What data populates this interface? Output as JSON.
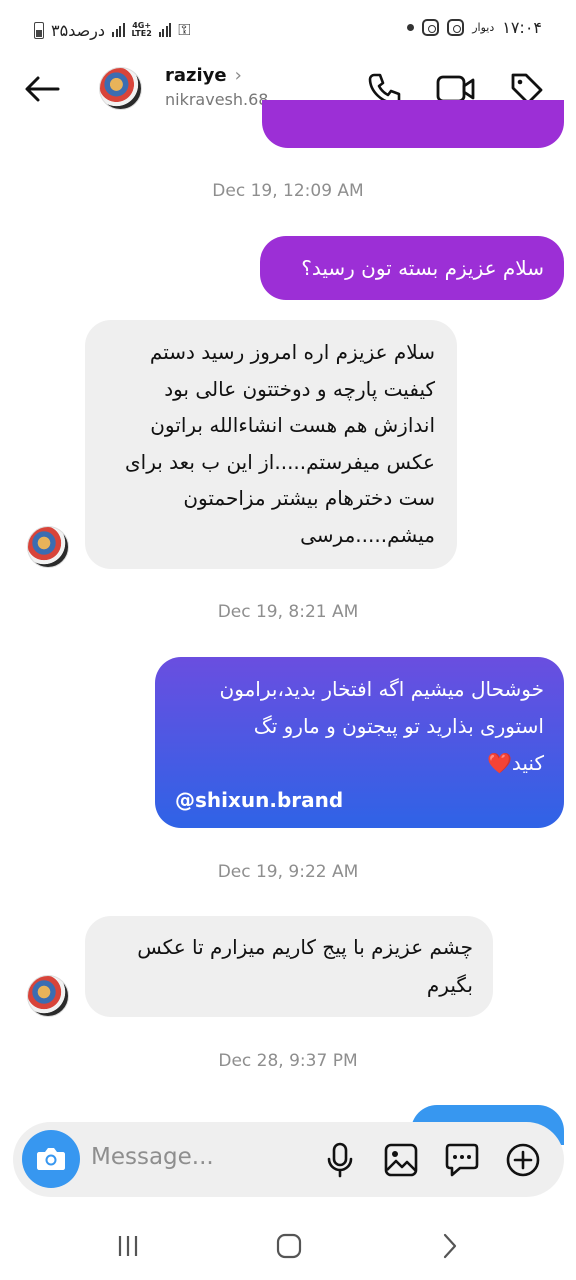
{
  "status_bar": {
    "battery_text": "۳۵درصد",
    "network": "4G+ Vo LTE2",
    "carrier": "دیوار",
    "time": "۱۷:۰۴"
  },
  "header": {
    "name": "raziye",
    "username": "nikravesh.68",
    "chevron": "›"
  },
  "timestamps": {
    "t1": "Dec 19, 12:09 AM",
    "t2": "Dec 19, 8:21 AM",
    "t3": "Dec 19, 9:22 AM",
    "t4": "Dec 28, 9:37 PM"
  },
  "messages": {
    "m1": "سلام عزیزم بسته تون رسید؟",
    "m2_lines": [
      "سلام عزیزم اره امروز رسید دستم",
      "کیفیت پارچه و دوختتون عالی بود",
      "اندازش هم هست انشاءالله براتون",
      "عکس میفرستم.....از این ب بعد برای",
      "ست دخترهام بیشتر مزاحمتون",
      "میشم.....مرسی"
    ],
    "m3_lines": [
      "خوشحال میشیم اگه افتخار بدید،برامون",
      "استوری بذارید تو پیجتون و مارو تگ",
      "کنید❤️"
    ],
    "m3_handle": "@shixun.brand",
    "m4_lines": [
      "چشم عزیزم با پیج کاریم میزارم تا عکس",
      "بگیرم"
    ]
  },
  "composer": {
    "placeholder": "Message..."
  },
  "colors": {
    "purple": "#9c2fd6",
    "blue_gradient_start": "#6a4ee0",
    "blue_gradient_end": "#2f63e6",
    "light_blue": "#3797f0",
    "incoming_bg": "#efefef"
  },
  "icons": [
    "back-arrow-icon",
    "phone-icon",
    "video-icon",
    "tag-icon",
    "camera-icon",
    "microphone-icon",
    "gallery-icon",
    "sticker-icon",
    "plus-icon",
    "recents-icon",
    "home-icon",
    "back-nav-icon"
  ]
}
